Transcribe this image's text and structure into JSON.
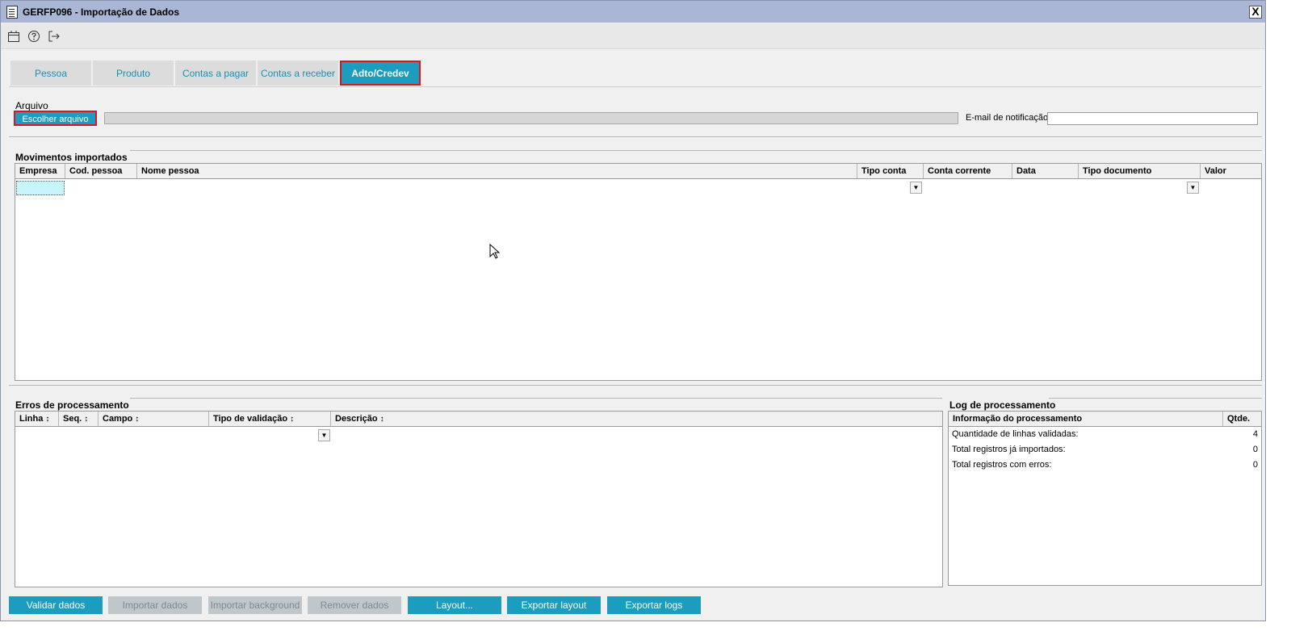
{
  "window": {
    "title": "GERFP096 - Importação de Dados",
    "close_label": "X"
  },
  "toolbar": {
    "icons": [
      "calendar-icon",
      "help-icon",
      "exit-icon"
    ]
  },
  "tabs": [
    {
      "label": "Pessoa"
    },
    {
      "label": "Produto"
    },
    {
      "label": "Contas a pagar"
    },
    {
      "label": "Contas a receber"
    },
    {
      "label": "Adto/Credev"
    }
  ],
  "arquivo": {
    "title": "Arquivo",
    "choose_button": "Escolher arquivo",
    "email_label": "E-mail de notificação",
    "email_value": ""
  },
  "movimentos": {
    "title": "Movimentos importados",
    "columns": [
      "Empresa",
      "Cod. pessoa",
      "Nome pessoa",
      "Tipo conta",
      "Conta corrente",
      "Data",
      "Tipo documento",
      "Valor"
    ]
  },
  "erros": {
    "title": "Erros de processamento",
    "columns": [
      "Linha",
      "Seq.",
      "Campo",
      "Tipo de validação",
      "Descrição"
    ],
    "sort_glyph": "↕"
  },
  "log": {
    "title": "Log de processamento",
    "columns": [
      "Informação do processamento",
      "Qtde."
    ],
    "rows": [
      {
        "label": "Quantidade de linhas validadas:",
        "qty": "4"
      },
      {
        "label": "Total registros já importados:",
        "qty": "0"
      },
      {
        "label": "Total registros com erros:",
        "qty": "0"
      }
    ]
  },
  "actions": {
    "validar": "Validar dados",
    "importar": "Importar dados",
    "importar_bg": "Importar background",
    "remover": "Remover dados",
    "layout": "Layout...",
    "exportar_layout": "Exportar layout",
    "exportar_logs": "Exportar logs"
  },
  "colors": {
    "accent": "#1c9cbf",
    "highlight": "#e0141e",
    "titlebar": "#a9b6d5",
    "disabled": "#bfc7cb"
  }
}
